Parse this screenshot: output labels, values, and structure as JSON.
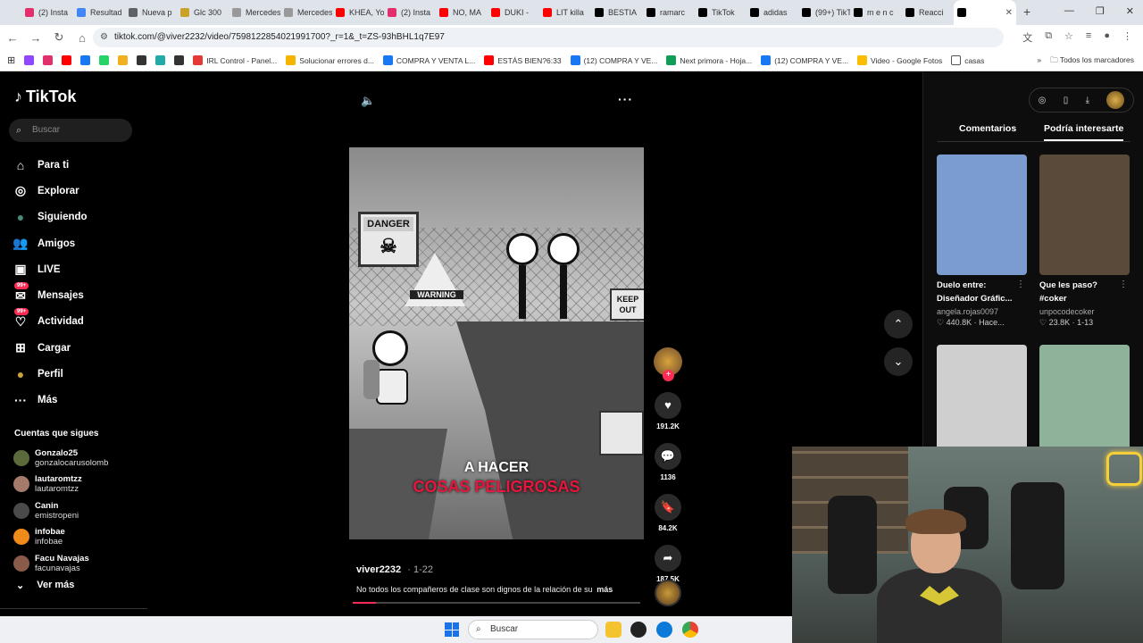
{
  "browser": {
    "tabs": [
      {
        "label": "(2) Insta",
        "color": "#e1306c"
      },
      {
        "label": "Resultad",
        "color": "#4285f4"
      },
      {
        "label": "Nueva p",
        "color": "#5f6368"
      },
      {
        "label": "Glc 300",
        "color": "#c9a227"
      },
      {
        "label": "Mercedes",
        "color": "#999999"
      },
      {
        "label": "Mercedes",
        "color": "#999999"
      },
      {
        "label": "KHEA, Yo",
        "color": "#ff0000"
      },
      {
        "label": "(2) Insta",
        "color": "#e1306c"
      },
      {
        "label": "NO, MA",
        "color": "#ff0000"
      },
      {
        "label": "DUKI -",
        "color": "#ff0000"
      },
      {
        "label": "LIT killa",
        "color": "#ff0000"
      },
      {
        "label": "BESTIA",
        "color": "#000000"
      },
      {
        "label": "ramarc",
        "color": "#000000"
      },
      {
        "label": "TikTok",
        "color": "#000000"
      },
      {
        "label": "adidas",
        "color": "#000000"
      },
      {
        "label": "(99+) TikT",
        "color": "#000000"
      },
      {
        "label": "m e n c",
        "color": "#000000"
      },
      {
        "label": "Reacci",
        "color": "#000000"
      },
      {
        "label": "",
        "color": "#000000"
      }
    ],
    "url": "tiktok.com/@viver2232/video/7598122854021991700?_r=1&_t=ZS-93hBHL1q7E97",
    "bookmarks": [
      {
        "label": "",
        "color": "#9146ff"
      },
      {
        "label": "",
        "color": "#e1306c"
      },
      {
        "label": "",
        "color": "#ff0000"
      },
      {
        "label": "",
        "color": "#1877f2"
      },
      {
        "label": "",
        "color": "#25d366"
      },
      {
        "label": "",
        "color": "#f2b01e"
      },
      {
        "label": "",
        "color": "#333333"
      },
      {
        "label": "",
        "color": "#22aaaa"
      },
      {
        "label": "",
        "color": "#333333"
      },
      {
        "label": "IRL Control - Panel...",
        "color": "#e53935"
      },
      {
        "label": "Solucionar errores d...",
        "color": "#f4b400"
      },
      {
        "label": "COMPRA Y VENTA L...",
        "color": "#1877f2"
      },
      {
        "label": "ESTÁS BIEN?6:33",
        "color": "#ff0000"
      },
      {
        "label": "(12) COMPRA Y VE...",
        "color": "#1877f2"
      },
      {
        "label": "Next primora - Hoja...",
        "color": "#0f9d58"
      },
      {
        "label": "(12) COMPRA Y VE...",
        "color": "#1877f2"
      },
      {
        "label": "Video - Google Fotos",
        "color": "#fbbc04"
      },
      {
        "label": "casas",
        "color": "#ffffff"
      }
    ],
    "all_bookmarks": "Todos los marcadores"
  },
  "tiktok": {
    "logo": "TikTok",
    "search_placeholder": "Buscar",
    "nav": [
      {
        "label": "Para ti",
        "icon": "home-icon"
      },
      {
        "label": "Explorar",
        "icon": "compass-icon"
      },
      {
        "label": "Siguiendo",
        "icon": "following-avatar"
      },
      {
        "label": "Amigos",
        "icon": "friends-icon"
      },
      {
        "label": "LIVE",
        "icon": "live-icon"
      },
      {
        "label": "Mensajes",
        "icon": "messages-icon",
        "badge": "99+"
      },
      {
        "label": "Actividad",
        "icon": "activity-icon",
        "badge": "99+"
      },
      {
        "label": "Cargar",
        "icon": "upload-icon"
      },
      {
        "label": "Perfil",
        "icon": "profile-avatar"
      },
      {
        "label": "Más",
        "icon": "more-icon"
      }
    ],
    "following_title": "Cuentas que sigues",
    "following": [
      {
        "name": "Gonzalo25",
        "handle": "gonzalocarusolomb"
      },
      {
        "name": "lautaromtzz",
        "handle": "lautaromtzz"
      },
      {
        "name": "Canin",
        "handle": "emistropeni"
      },
      {
        "name": "infobae",
        "handle": "infobae"
      },
      {
        "name": "Facu Navajas",
        "handle": "facunavajas"
      }
    ],
    "see_more": "Ver más",
    "video": {
      "sign_danger": "DANGER",
      "sign_warning": "WARNING",
      "sign_keep": "KEEP OUT",
      "caption_line1": "A HACER",
      "caption_line2": "COSAS PELIGROSAS",
      "username": "viver2232",
      "date": "1-22",
      "description": "No todos los compañeros de clase son dignos de la relación de su",
      "more": "más",
      "progress": 0.08
    },
    "actions": {
      "likes": "191.2K",
      "comments": "1136",
      "saves": "84.2K",
      "shares": "187.5K"
    },
    "right_tabs": [
      "Comentarios",
      "Podría interesarte"
    ],
    "cards": [
      {
        "title1": "Duelo entre:",
        "title2": "Diseñador Gráfic...",
        "user": "angela.rojas0097",
        "stats": "♡ 440.8K · Hace...",
        "color": "#7a9ccf"
      },
      {
        "title1": "Que les paso?",
        "title2": "#coker",
        "user": "unpocodecoker",
        "stats": "♡ 23.8K · 1-13",
        "color": "#5a4a3a"
      },
      {
        "title1": "",
        "title2": "",
        "user": "",
        "stats": "",
        "color": "#cfcfcf"
      },
      {
        "title1": "",
        "title2": "",
        "user": "",
        "stats": "",
        "color": "#8fb39a"
      }
    ]
  },
  "taskbar": {
    "search_placeholder": "Buscar"
  }
}
